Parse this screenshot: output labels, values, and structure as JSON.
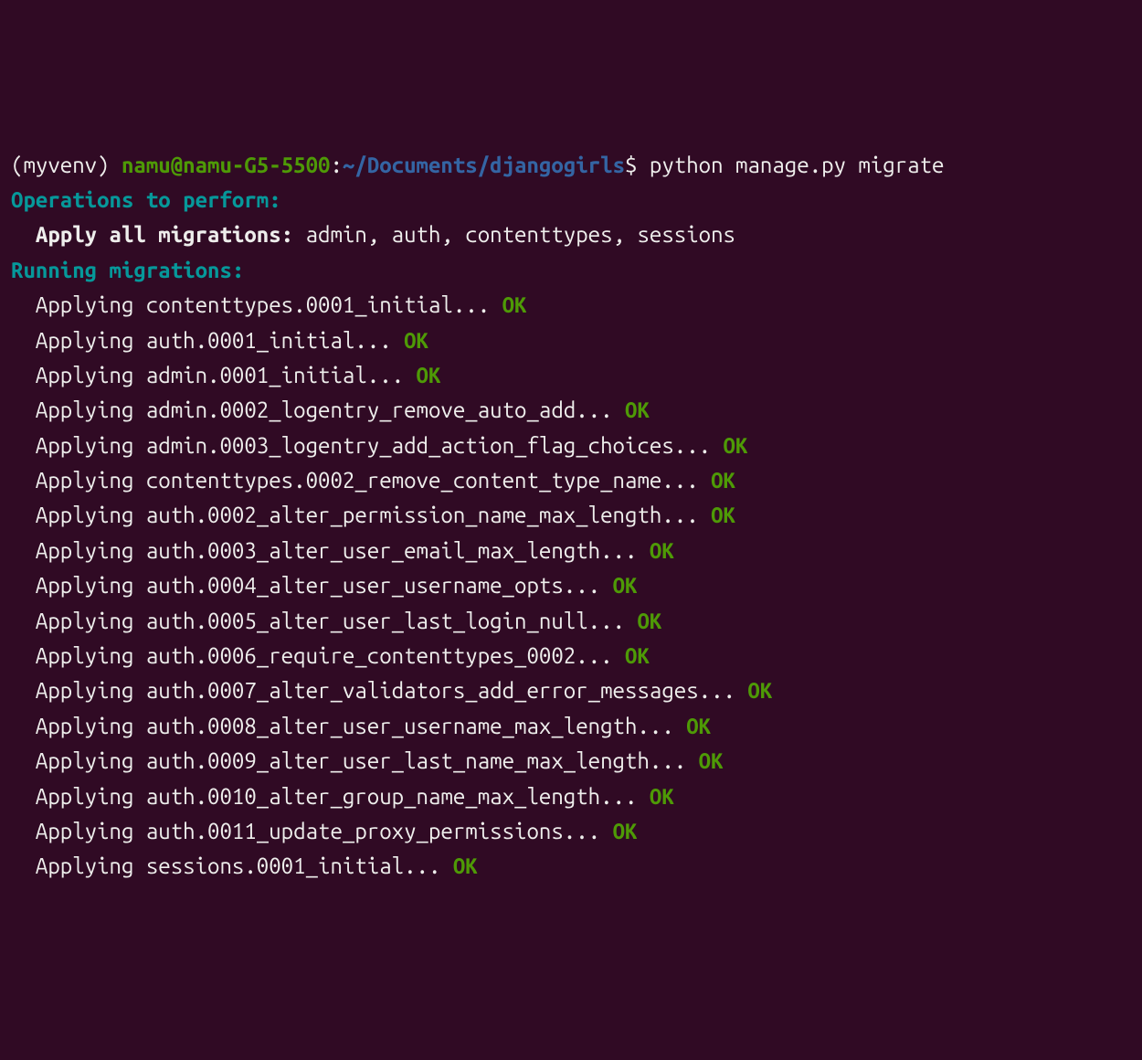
{
  "prompt": {
    "venv": "(myvenv) ",
    "user_host": "namu@namu-G5-5500",
    "colon": ":",
    "path": "~/Documents/djangogirls",
    "dollar": "$ ",
    "command": "python manage.py migrate"
  },
  "headers": {
    "operations": "Operations to perform:",
    "apply_all_label": "  Apply all migrations: ",
    "apply_all_list": "admin, auth, contenttypes, sessions",
    "running": "Running migrations:"
  },
  "apply_prefix": "  Applying ",
  "ok_label": "OK",
  "migrations": [
    "contenttypes.0001_initial... ",
    "auth.0001_initial... ",
    "admin.0001_initial... ",
    "admin.0002_logentry_remove_auto_add... ",
    "admin.0003_logentry_add_action_flag_choices... ",
    "contenttypes.0002_remove_content_type_name... ",
    "auth.0002_alter_permission_name_max_length... ",
    "auth.0003_alter_user_email_max_length... ",
    "auth.0004_alter_user_username_opts... ",
    "auth.0005_alter_user_last_login_null... ",
    "auth.0006_require_contenttypes_0002... ",
    "auth.0007_alter_validators_add_error_messages... ",
    "auth.0008_alter_user_username_max_length... ",
    "auth.0009_alter_user_last_name_max_length... ",
    "auth.0010_alter_group_name_max_length... ",
    "auth.0011_update_proxy_permissions... ",
    "sessions.0001_initial... "
  ]
}
